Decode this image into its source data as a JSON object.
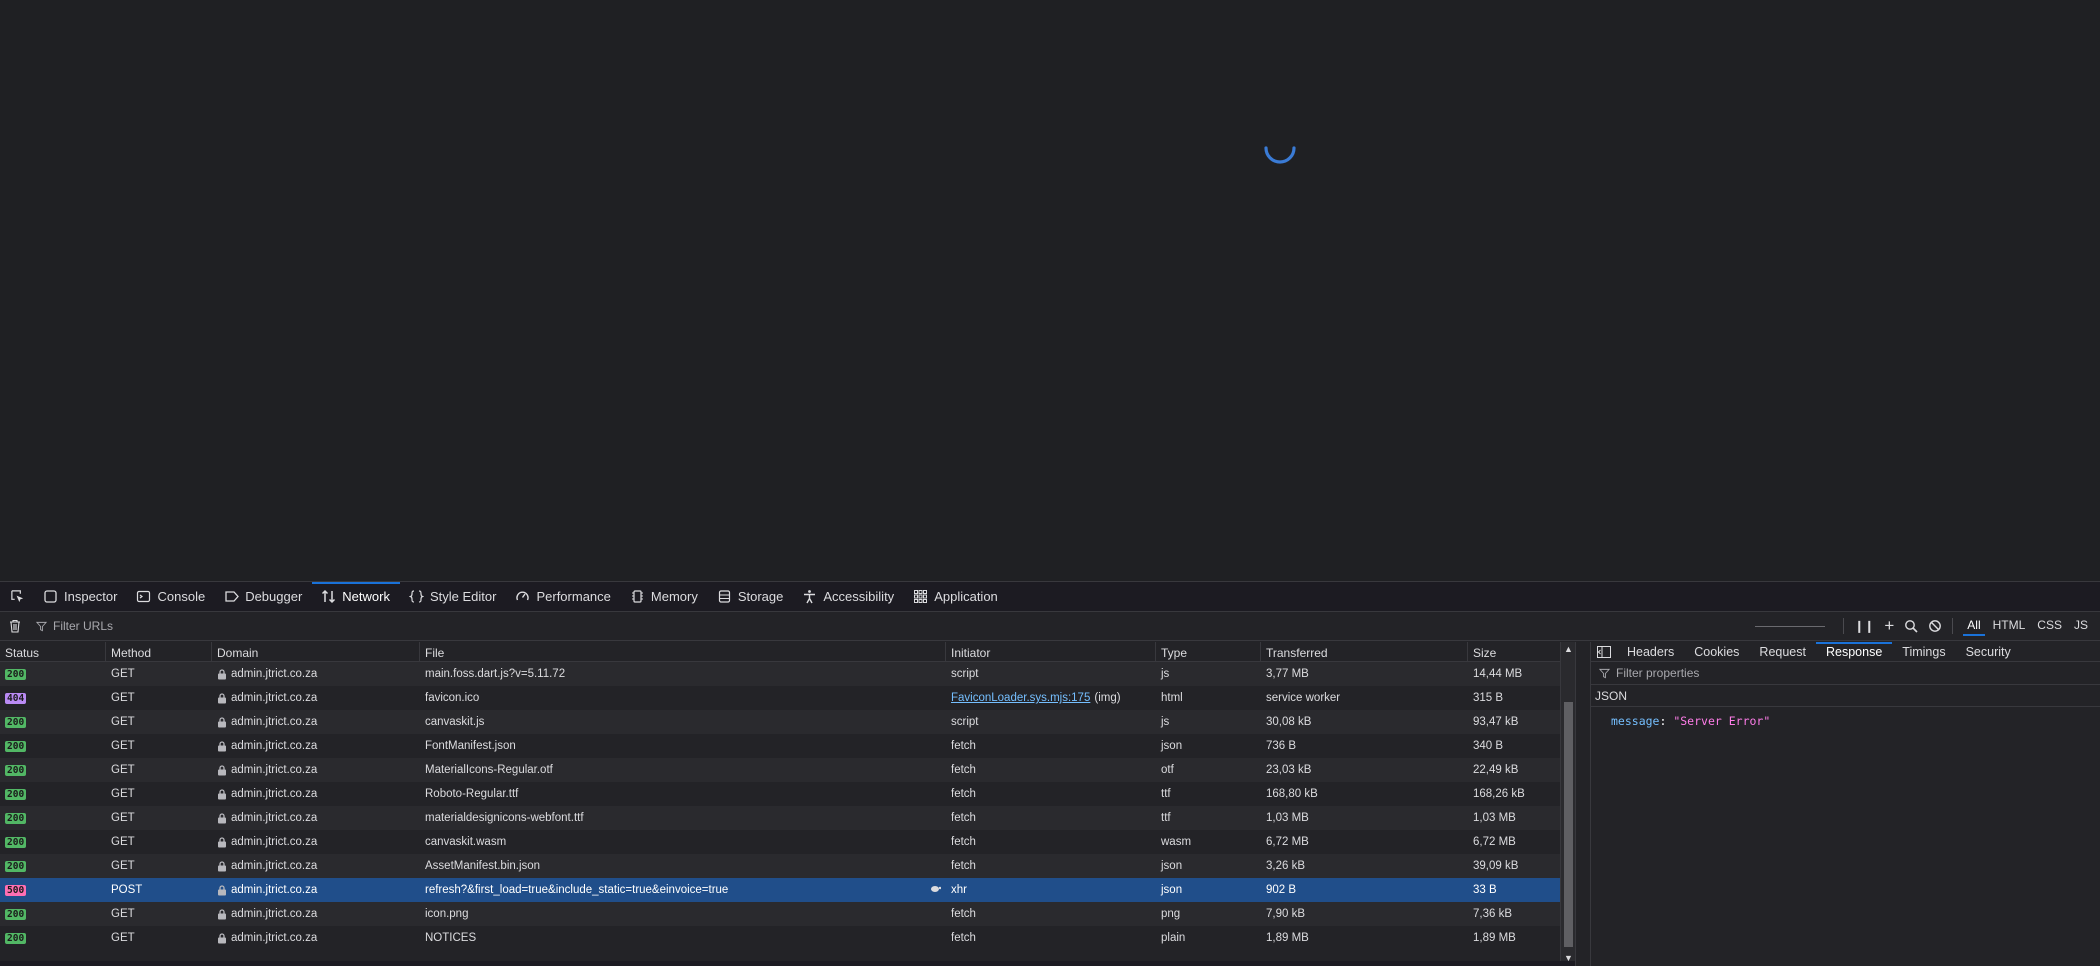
{
  "devtools": {
    "tabs": [
      {
        "label": "Inspector",
        "icon": "inspector-icon"
      },
      {
        "label": "Console",
        "icon": "console-icon"
      },
      {
        "label": "Debugger",
        "icon": "debugger-icon"
      },
      {
        "label": "Network",
        "icon": "network-icon",
        "active": true
      },
      {
        "label": "Style Editor",
        "icon": "style-editor-icon"
      },
      {
        "label": "Performance",
        "icon": "performance-icon"
      },
      {
        "label": "Memory",
        "icon": "memory-icon"
      },
      {
        "label": "Storage",
        "icon": "storage-icon"
      },
      {
        "label": "Accessibility",
        "icon": "accessibility-icon"
      },
      {
        "label": "Application",
        "icon": "application-icon"
      }
    ]
  },
  "toolbar": {
    "filter_placeholder": "Filter URLs",
    "type_filters": [
      "All",
      "HTML",
      "CSS",
      "JS"
    ],
    "active_type_filter": "All"
  },
  "requests": {
    "columns": [
      "Status",
      "Method",
      "Domain",
      "File",
      "Initiator",
      "Type",
      "Transferred",
      "Size"
    ],
    "rows": [
      {
        "status": "200",
        "method": "GET",
        "domain": "admin.jtrict.co.za",
        "file": "main.foss.dart.js?v=5.11.72",
        "initiator": "script",
        "initiator_extra": "",
        "type": "js",
        "transferred": "3,77 MB",
        "size": "14,44 MB"
      },
      {
        "status": "404",
        "method": "GET",
        "domain": "admin.jtrict.co.za",
        "file": "favicon.ico",
        "initiator": "FaviconLoader.sys.mjs:175",
        "initiator_extra": "(img)",
        "type": "html",
        "transferred": "service worker",
        "size": "315 B"
      },
      {
        "status": "200",
        "method": "GET",
        "domain": "admin.jtrict.co.za",
        "file": "canvaskit.js",
        "initiator": "script",
        "initiator_extra": "",
        "type": "js",
        "transferred": "30,08 kB",
        "size": "93,47 kB"
      },
      {
        "status": "200",
        "method": "GET",
        "domain": "admin.jtrict.co.za",
        "file": "FontManifest.json",
        "initiator": "fetch",
        "initiator_extra": "",
        "type": "json",
        "transferred": "736 B",
        "size": "340 B"
      },
      {
        "status": "200",
        "method": "GET",
        "domain": "admin.jtrict.co.za",
        "file": "MaterialIcons-Regular.otf",
        "initiator": "fetch",
        "initiator_extra": "",
        "type": "otf",
        "transferred": "23,03 kB",
        "size": "22,49 kB"
      },
      {
        "status": "200",
        "method": "GET",
        "domain": "admin.jtrict.co.za",
        "file": "Roboto-Regular.ttf",
        "initiator": "fetch",
        "initiator_extra": "",
        "type": "ttf",
        "transferred": "168,80 kB",
        "size": "168,26 kB"
      },
      {
        "status": "200",
        "method": "GET",
        "domain": "admin.jtrict.co.za",
        "file": "materialdesignicons-webfont.ttf",
        "initiator": "fetch",
        "initiator_extra": "",
        "type": "ttf",
        "transferred": "1,03 MB",
        "size": "1,03 MB"
      },
      {
        "status": "200",
        "method": "GET",
        "domain": "admin.jtrict.co.za",
        "file": "canvaskit.wasm",
        "initiator": "fetch",
        "initiator_extra": "",
        "type": "wasm",
        "transferred": "6,72 MB",
        "size": "6,72 MB"
      },
      {
        "status": "200",
        "method": "GET",
        "domain": "admin.jtrict.co.za",
        "file": "AssetManifest.bin.json",
        "initiator": "fetch",
        "initiator_extra": "",
        "type": "json",
        "transferred": "3,26 kB",
        "size": "39,09 kB"
      },
      {
        "status": "500",
        "method": "POST",
        "domain": "admin.jtrict.co.za",
        "file": "refresh?&first_load=true&include_static=true&einvoice=true",
        "initiator": "xhr",
        "initiator_extra": "",
        "type": "json",
        "transferred": "902 B",
        "size": "33 B",
        "selected": true
      },
      {
        "status": "200",
        "method": "GET",
        "domain": "admin.jtrict.co.za",
        "file": "icon.png",
        "initiator": "fetch",
        "initiator_extra": "",
        "type": "png",
        "transferred": "7,90 kB",
        "size": "7,36 kB"
      },
      {
        "status": "200",
        "method": "GET",
        "domain": "admin.jtrict.co.za",
        "file": "NOTICES",
        "initiator": "fetch",
        "initiator_extra": "",
        "type": "plain",
        "transferred": "1,89 MB",
        "size": "1,89 MB"
      }
    ]
  },
  "sidebar": {
    "tabs": [
      "Headers",
      "Cookies",
      "Request",
      "Response",
      "Timings",
      "Security"
    ],
    "active_tab": "Response",
    "filter_placeholder": "Filter properties",
    "section_label": "JSON",
    "json": [
      {
        "key": "message",
        "value": "\"Server Error\""
      }
    ]
  },
  "colors": {
    "accent": "#1a72d9",
    "selected_row": "#204e8a",
    "status_200": "#52b765",
    "status_404": "#b98af3",
    "status_500": "#ff6fb3",
    "spinner": "#3a7bd5"
  }
}
